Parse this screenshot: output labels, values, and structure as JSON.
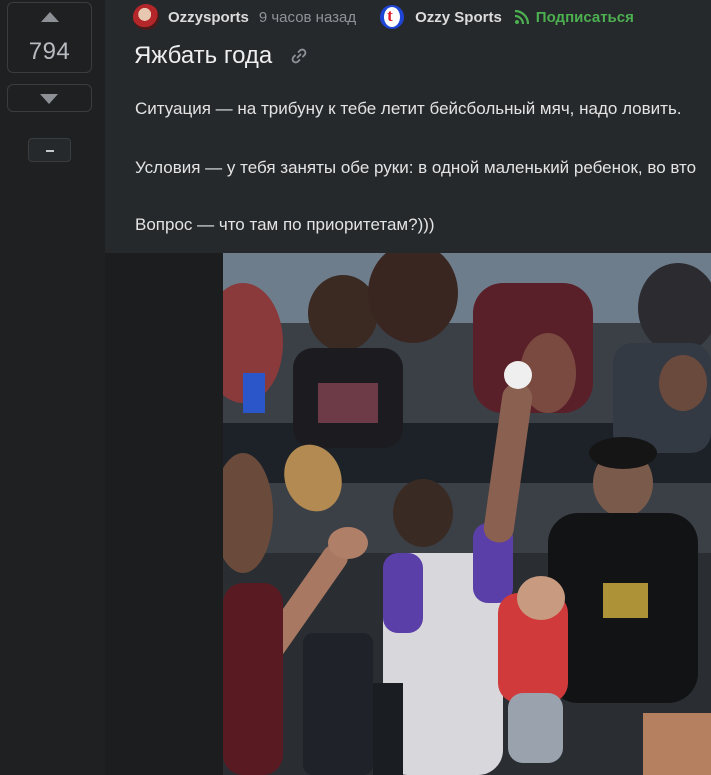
{
  "vote": {
    "score": "794"
  },
  "post": {
    "author": "Ozzysports",
    "time": "9 часов назад",
    "community": "Ozzy Sports",
    "community_logo_letter": "t",
    "subscribe_label": "Подписаться",
    "title": "Яжбать года",
    "paragraphs": [
      "Ситуация — на трибуну к тебе летит бейсбольный мяч, надо ловить.",
      "Условия — у тебя заняты обе руки: в одной маленький ребенок, во вто",
      "Вопрос — что там по приоритетам?)))"
    ]
  },
  "colors": {
    "background": "#1e2022",
    "card": "#26292c",
    "subscribe_green": "#4caf50",
    "community_blue": "#1f45d6",
    "community_red": "#e11d2a"
  },
  "icons": [
    "up-arrow-icon",
    "down-arrow-icon",
    "collapse-icon",
    "link-icon",
    "rss-subscribe-icon"
  ]
}
